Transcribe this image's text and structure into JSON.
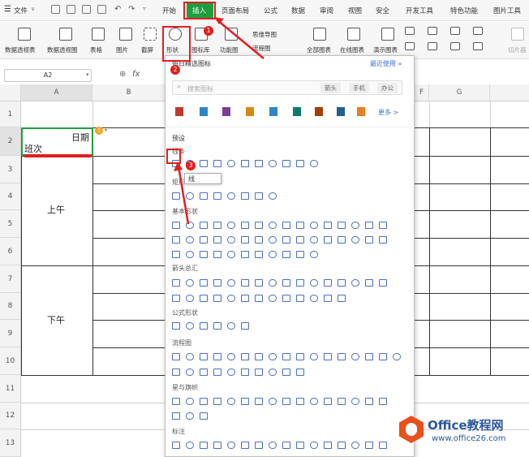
{
  "menubar": {
    "file": "文件",
    "tabs": [
      "开始",
      "插入",
      "页面布局",
      "公式",
      "数据",
      "审阅",
      "视图",
      "安全",
      "开发工具",
      "特色功能",
      "图片工具"
    ],
    "active_tab": "插入"
  },
  "toolbar": {
    "items": [
      "数据透视表",
      "数据透视图",
      "表格",
      "图片",
      "截屏",
      "形状",
      "图标库",
      "功能图",
      "思维导图",
      "流程图",
      "全部图表",
      "在线图表",
      "演示图表",
      "切片器"
    ]
  },
  "formula_bar": {
    "name_box": "A2",
    "fx": "fx"
  },
  "sheet": {
    "columns": [
      "A",
      "B",
      "F",
      "G"
    ],
    "rows": [
      "1",
      "2",
      "3",
      "4",
      "5",
      "6",
      "7",
      "8",
      "9",
      "10",
      "11",
      "12",
      "13"
    ],
    "cell_date": "日期",
    "cell_shift": "班次",
    "morning": "上午",
    "afternoon": "下午"
  },
  "dropdown": {
    "header": "每日精选图标",
    "recent": "最近使用 »",
    "search_placeholder": "搜索图标",
    "tags": [
      "箭头",
      "手机",
      "办公"
    ],
    "more": "更多 >",
    "preset": "预设",
    "sections": [
      "线条",
      "矩形",
      "基本形状",
      "箭头总汇",
      "公式形状",
      "流程图",
      "星与旗帜",
      "标注"
    ],
    "tooltip": "线"
  },
  "annotations": [
    "1",
    "2",
    "3"
  ],
  "watermark": {
    "brand": "Office教程网",
    "url": "www.office26.com"
  },
  "colors": {
    "accent_green": "#1e9e3f",
    "highlight_red": "#e02020",
    "shape_blue": "#4a6fbf"
  }
}
